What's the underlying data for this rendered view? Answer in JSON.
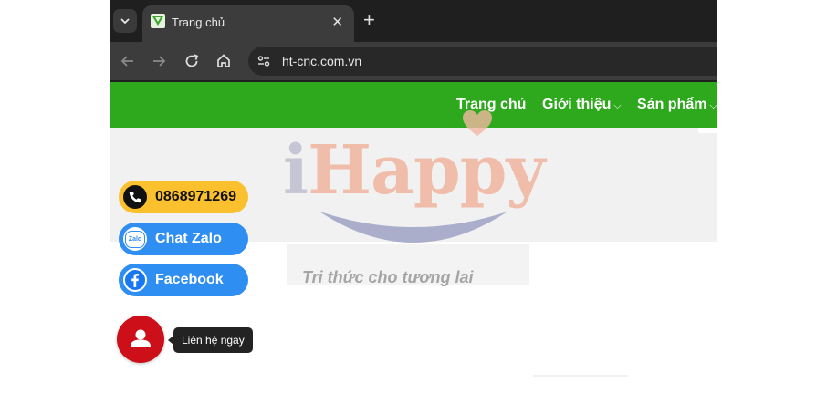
{
  "browser": {
    "tab_title": "Trang chủ",
    "tab_close": "✕",
    "new_tab": "+",
    "url": "ht-cnc.com.vn"
  },
  "site": {
    "menu": [
      {
        "label": "Trang chủ",
        "chevron": ""
      },
      {
        "label": "Giới thiệu",
        "chevron": "⌵"
      },
      {
        "label": "Sản phẩm",
        "chevron": "⌵"
      }
    ],
    "logo": {
      "letter_i": "i",
      "rest": "Happy",
      "tagline": "Tri thức cho tương lai"
    }
  },
  "contact_widget": {
    "phone": {
      "label": "0868971269",
      "bg": "#fbc02d",
      "text_color": "#111111"
    },
    "zalo": {
      "label": "Chat Zalo",
      "icon_text": "Zalo",
      "bg": "#2f8ef2",
      "text_color": "#ffffff"
    },
    "facebook": {
      "label": "Facebook",
      "bg": "#2f8ef2",
      "text_color": "#ffffff"
    },
    "contact_now": {
      "tooltip": "Liên hệ ngay"
    }
  },
  "colors": {
    "nav_green": "#2ea81d",
    "contact_red": "#cc0f19"
  },
  "icons": [
    "tab-list-icon",
    "favicon-icon",
    "close-icon",
    "plus-icon",
    "back-arrow-icon",
    "forward-arrow-icon",
    "reload-icon",
    "home-icon",
    "site-info-icon",
    "phone-icon",
    "zalo-icon",
    "facebook-icon",
    "user-icon"
  ]
}
